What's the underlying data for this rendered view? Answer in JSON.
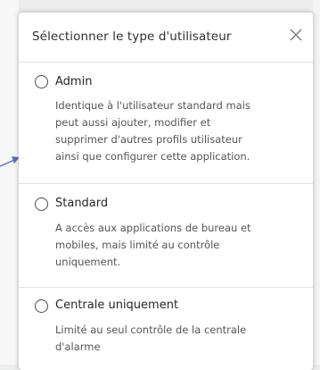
{
  "dialog": {
    "title": "Sélectionner le type d'utilisateur",
    "close_icon": "close-icon"
  },
  "options": [
    {
      "label": "Admin",
      "selected": false,
      "description_lines": [
        "Identique à l'utilisateur standard mais",
        "peut aussi ajouter, modifier et",
        "supprimer d'autres profils utilisateur",
        "ainsi que configurer cette application."
      ]
    },
    {
      "label": "Standard",
      "selected": false,
      "description_lines": [
        "A accès aux applications de bureau et",
        "mobiles, mais limité au contrôle",
        "uniquement."
      ]
    },
    {
      "label": "Centrale uniquement",
      "selected": false,
      "description_lines": [
        "Limité au seul contrôle de la centrale",
        "d'alarme"
      ]
    }
  ],
  "colors": {
    "annotation_arrow": "#4a72c4"
  }
}
